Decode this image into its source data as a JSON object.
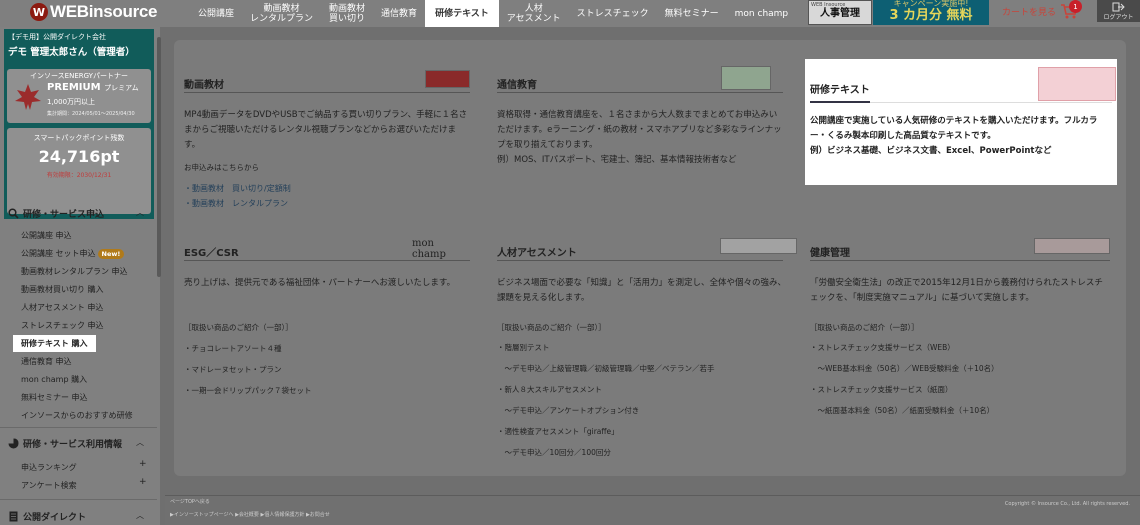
{
  "header": {
    "logo_text": "WEBinsource",
    "nav": [
      {
        "label": "公開講座"
      },
      {
        "label": "動画教材\nレンタルプラン"
      },
      {
        "label": "動画教材\n買い切り"
      },
      {
        "label": "通信教育"
      },
      {
        "label": "研修テキスト",
        "active": true
      },
      {
        "label": "人材\nアセスメント"
      },
      {
        "label": "ストレスチェック"
      },
      {
        "label": "無料セミナー"
      },
      {
        "label": "mon champ"
      }
    ],
    "promo_hr_small": "WEB Insource",
    "promo_hr_big": "人事管理",
    "promo_free_top": "キャンペーン実施中!",
    "promo_free_big": "3 カ月分 無料",
    "cart_label": "カートを見る",
    "cart_count": "1",
    "logout_label": "ログアウト"
  },
  "sidebar": {
    "company": "【デモ用】公開ダイレクト会社",
    "user": "デモ 管理太郎さん（管理者）",
    "energy_title": "インソースENERGYパートナー",
    "energy_rank": "PREMIUM",
    "energy_rank_sub": "プレミアム",
    "energy_req": "1,000万円以上",
    "energy_period": "集計期間：2024/05/01～2025/04/30",
    "points_label": "スマートパックポイント残数",
    "points_value": "24,716pt",
    "points_expiry": "有効期限：2030/12/31",
    "section1": "研修・サービス申込",
    "items1": [
      "公開講座 申込",
      "公開講座 セット申込",
      "動画教材レンタルプラン 申込",
      "動画教材買い切り 購入",
      "人材アセスメント 申込",
      "ストレスチェック 申込",
      "研修テキスト 購入",
      "通信教育 申込",
      "mon champ 購入",
      "無料セミナー 申込",
      "インソースからのおすすめ研修"
    ],
    "new_badge": "New!",
    "section2": "研修・サービス利用情報",
    "items2": [
      "申込ランキング",
      "アンケート検索"
    ],
    "section3": "公開ダイレクト"
  },
  "cards": {
    "video": {
      "title": "動画教材",
      "body": "MP4動画データをDVDやUSBでご納品する買い切りプラン、手軽に１名さまからご視聴いただけるレンタル視聴プランなどからお選びいただけます。",
      "sub": "お申込みはこちらから",
      "links": [
        "・動画教材　買い切り/定額制",
        "・動画教材　レンタルプラン"
      ]
    },
    "correspondence": {
      "title": "通信教育",
      "body": "資格取得・通信教育講座を、１名さまから大人数までまとめてお申込みいただけます。eラーニング・紙の教材・スマホアプリなど多彩なラインナップを取り揃えております。\n例）MOS、ITパスポート、宅建士、簿記、基本情報技術者など"
    },
    "texts": {
      "title": "研修テキスト",
      "body": "公開講座で実施している人気研修のテキストを購入いただけます。フルカラー・くるみ製本印刷した高品質なテキストです。\n例）ビジネス基礎、ビジネス文書、Excel、PowerPointなど"
    },
    "esg": {
      "title": "ESG／CSR",
      "logo": "mon champ",
      "body": "売り上げは、提供元である福祉団体・パートナーへお渡しいたします。",
      "list_head": "［取扱い商品のご紹介（一部）］",
      "list": [
        "・チョコレートアソート４種",
        "・マドレーヌセット・プラン",
        "・一期一会ドリップパック７袋セット"
      ]
    },
    "assessment": {
      "title": "人材アセスメント",
      "body": "ビジネス場面で必要な「知識」と「活用力」を測定し、全体や個々の強み、課題を見える化します。",
      "list_head": "［取扱い商品のご紹介（一部）］",
      "list": [
        "・階層別テスト",
        "　～デモ申込／上級管理職／初級管理職／中堅／ベテラン／若手",
        "・新人８大スキルアセスメント",
        "　～デモ申込／アンケートオプション付き",
        "・適性検査アセスメント「giraffe」",
        "　～デモ申込／10回分／100回分"
      ]
    },
    "health": {
      "title": "健康管理",
      "body": "「労働安全衛生法」の改正で2015年12月1日から義務付けられたストレスチェックを、「制度実施マニュアル」に基づいて実施します。",
      "list_head": "［取扱い商品のご紹介（一部）］",
      "list": [
        "・ストレスチェック支援サービス（WEB）",
        "　～WEB基本料金（50名）／WEB受験料金（＋10名）",
        "・ストレスチェック支援サービス（紙面）",
        "　～紙面基本料金（50名）／紙面受験料金（＋10名）"
      ]
    }
  },
  "footer": {
    "top_link": "ページTOPへ戻る",
    "links": "▶インソーストップページへ ▶会社概要 ▶個人情報保護方針 ▶お問合せ",
    "copyright": "Copyright © Insource Co., Ltd. All rights reserved."
  }
}
